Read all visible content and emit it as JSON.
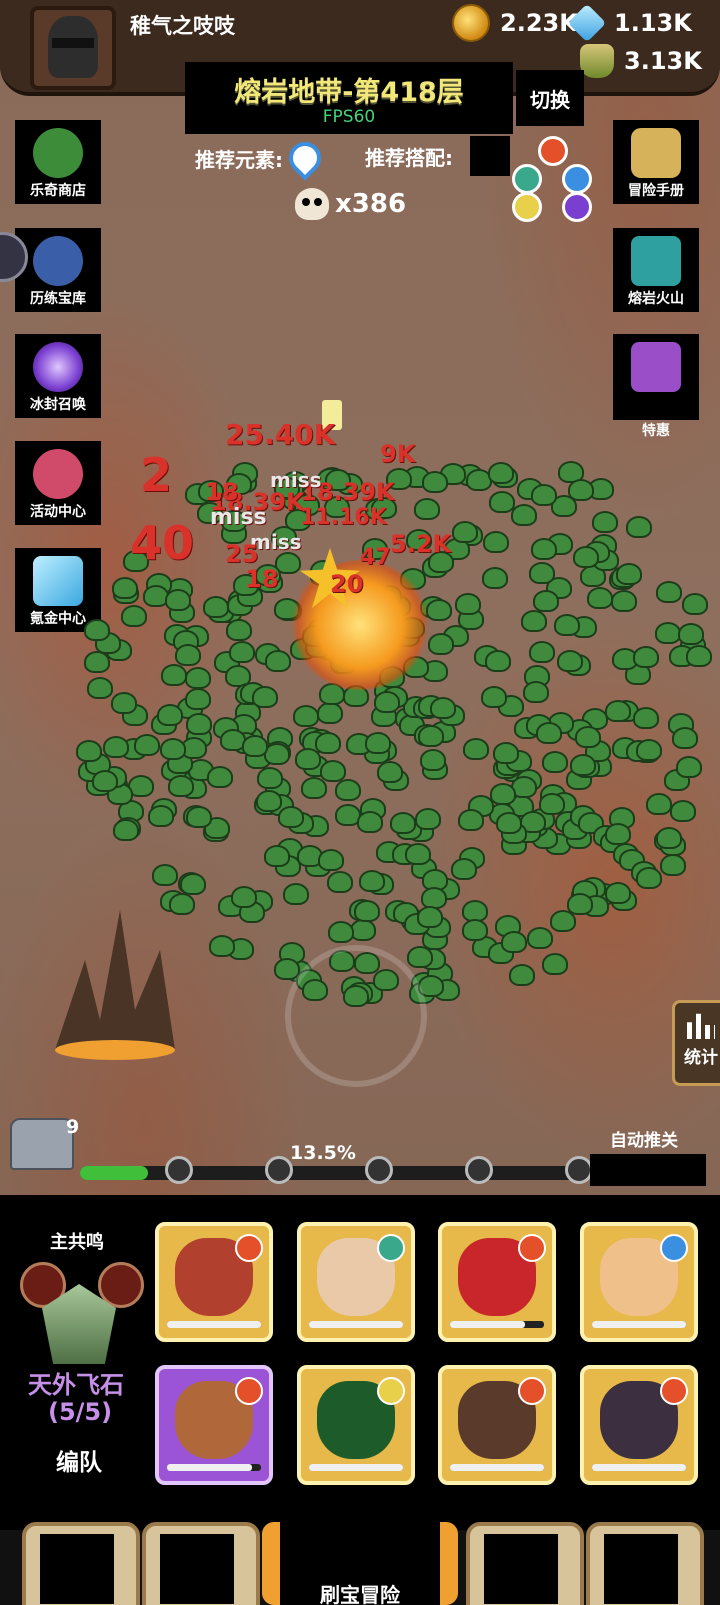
{
  "header": {
    "player_name": "稚气之吱吱",
    "gold": "2.23K",
    "gems": "1.13K",
    "potions": "3.13K"
  },
  "stage": {
    "title": "熔岩地带-第418层",
    "fps": "FPS60",
    "switch_label": "切换",
    "recommended_element_label": "推荐元素:",
    "recommended_combo_label": "推荐搭配:",
    "kill_count": "x386"
  },
  "left_menu": [
    {
      "label": "乐奇商店",
      "icon": "clover-icon",
      "color": "#3c8c3a"
    },
    {
      "label": "历练宝库",
      "icon": "treasure-vase-icon",
      "color": "#3a5fa8"
    },
    {
      "label": "冰封召唤",
      "icon": "portal-icon",
      "color": "#7a3fd0"
    },
    {
      "label": "活动中心",
      "icon": "bouquet-icon",
      "color": "#d04a6a"
    },
    {
      "label": "氪金中心",
      "icon": "diamond-icon",
      "color": "#3aa8e0"
    }
  ],
  "right_menu": [
    {
      "label": "冒险手册",
      "icon": "scroll-icon",
      "color": "#d6b25a"
    },
    {
      "label": "熔岩火山",
      "icon": "chest-icon",
      "color": "#2fa0a0"
    },
    {
      "label": "特惠",
      "icon": "gift-chest-icon",
      "color": "#9a4fc8"
    }
  ],
  "damage_numbers": [
    "25.40K",
    "18.39K",
    "18.39K",
    "11.16K",
    "miss",
    "miss",
    "miss",
    "2",
    "40",
    "18",
    "25",
    "18",
    "20",
    "47",
    "5.2K",
    "9K"
  ],
  "stats_label": "统计",
  "progress": {
    "chest_count": "9",
    "percent_text": "13.5%",
    "fraction": 0.135,
    "auto_push_label": "自动推关"
  },
  "team": {
    "leader_label": "主共鸣",
    "set_name": "天外飞石",
    "set_count": "(5/5)",
    "formation_label": "编队",
    "heroes": [
      {
        "skin": "#b2402f",
        "element": "#e4502a",
        "hp": 1.0
      },
      {
        "skin": "#e9c9a8",
        "element": "#3aa88a",
        "hp": 1.0
      },
      {
        "skin": "#c8262a",
        "element": "#e4502a",
        "hp": 0.8
      },
      {
        "skin": "#f0c08a",
        "element": "#3a8fe0",
        "hp": 1.0
      },
      {
        "skin": "#b0673a",
        "element": "#e4502a",
        "hp": 0.9
      },
      {
        "skin": "#1e5b2a",
        "element": "#e8d04a",
        "hp": 1.0
      },
      {
        "skin": "#5a3a2a",
        "element": "#e4502a",
        "hp": 1.0
      },
      {
        "skin": "#3c3040",
        "element": "#e4502a",
        "hp": 1.0
      }
    ]
  },
  "nav": {
    "main_label": "刷宝冒险"
  }
}
